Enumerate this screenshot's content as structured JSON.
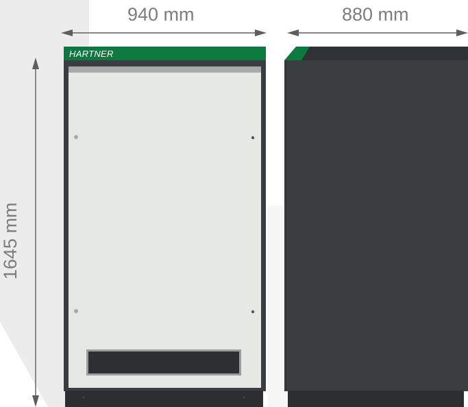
{
  "dimensions": {
    "width_label": "940 mm",
    "depth_label": "880 mm",
    "height_label": "1645 mm"
  },
  "cabinet": {
    "brand": "HARTNER",
    "brand_color": "#0c7a3e",
    "body_color": "#3b3e41",
    "front_panel_color": "#e6e8e6",
    "base_color": "#2c2e30"
  },
  "colors": {
    "arrow": "#5e5e5e",
    "label": "#7d7d7d",
    "background_shade": "#ececec"
  }
}
